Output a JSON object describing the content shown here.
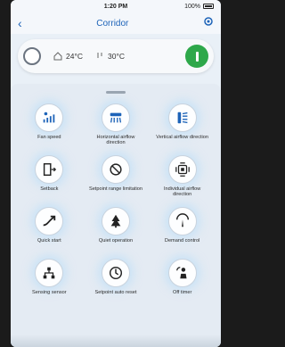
{
  "status_bar": {
    "time": "1:20 PM",
    "battery": "100%"
  },
  "header": {
    "title": "Corridor"
  },
  "status": {
    "room_temp": "24°C",
    "set_temp": "30°C"
  },
  "functions": [
    {
      "label": "Fan speed"
    },
    {
      "label": "Horizontal airflow direction"
    },
    {
      "label": "Vertical airflow direction"
    },
    {
      "label": "Setback"
    },
    {
      "label": "Setpoint range limitation"
    },
    {
      "label": "Individual airflow direction"
    },
    {
      "label": "Quick start"
    },
    {
      "label": "Quiet operation"
    },
    {
      "label": "Demand control"
    },
    {
      "label": "Sensing sensor"
    },
    {
      "label": "Setpoint auto reset"
    },
    {
      "label": "Off timer"
    }
  ],
  "colors": {
    "accent": "#1d63b8",
    "power_on": "#2ea84a"
  }
}
